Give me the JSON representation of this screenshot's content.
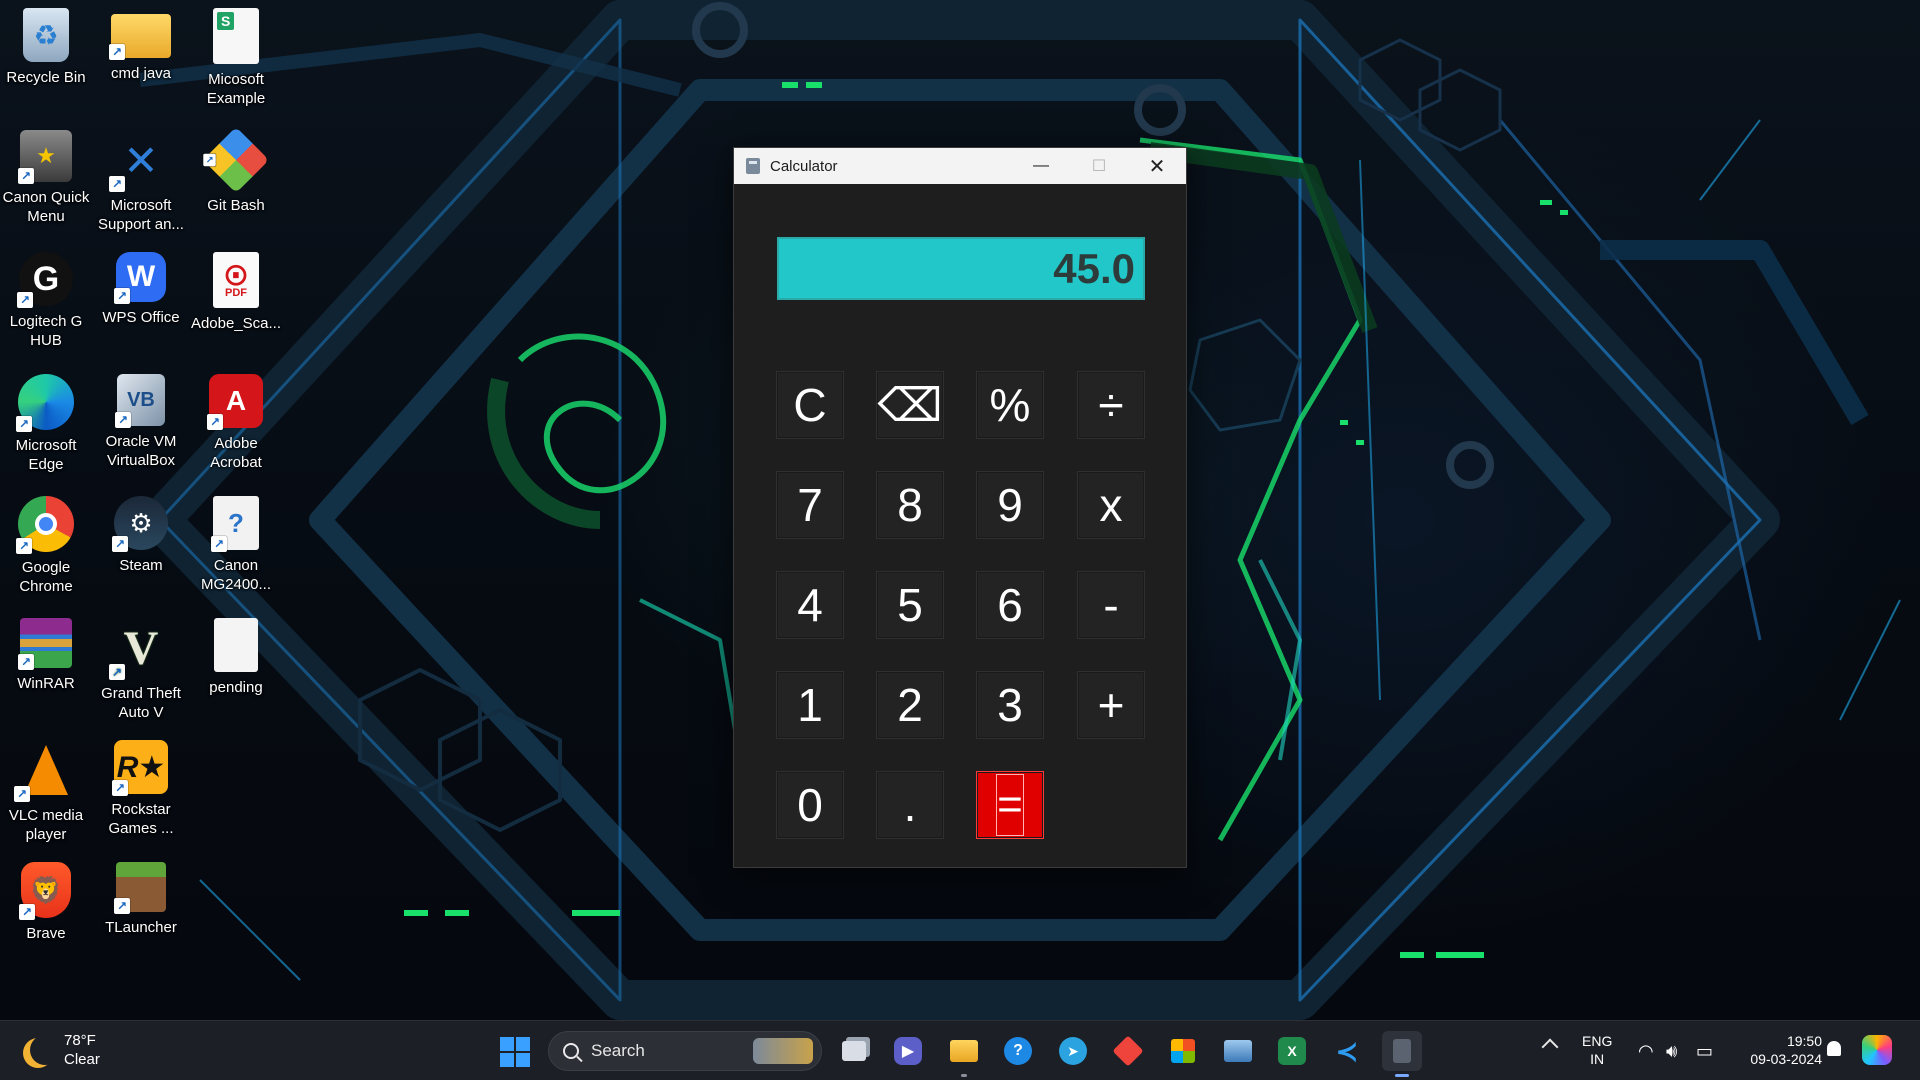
{
  "desktop": {
    "icons": [
      {
        "label": "Recycle Bin",
        "icon": "recycle-bin-icon"
      },
      {
        "label": "cmd java",
        "icon": "folder-icon"
      },
      {
        "label": "Micosoft\nExample",
        "icon": "spreadsheet-file-icon"
      },
      {
        "label": "Canon Quick\nMenu",
        "icon": "canon-quick-menu-icon"
      },
      {
        "label": "Microsoft\nSupport an...",
        "icon": "microsoft-support-icon"
      },
      {
        "label": "Git Bash",
        "icon": "git-bash-icon"
      },
      {
        "label": "Logitech G\nHUB",
        "icon": "logitech-g-hub-icon"
      },
      {
        "label": "WPS Office",
        "icon": "wps-office-icon"
      },
      {
        "label": "Adobe_Sca...",
        "icon": "pdf-file-icon"
      },
      {
        "label": "Microsoft\nEdge",
        "icon": "edge-icon"
      },
      {
        "label": "Oracle VM\nVirtualBox",
        "icon": "virtualbox-icon"
      },
      {
        "label": "Adobe\nAcrobat",
        "icon": "adobe-acrobat-icon"
      },
      {
        "label": "Google\nChrome",
        "icon": "chrome-icon"
      },
      {
        "label": "Steam",
        "icon": "steam-icon"
      },
      {
        "label": "Canon\nMG2400...",
        "icon": "canon-printer-help-icon"
      },
      {
        "label": "WinRAR",
        "icon": "winrar-icon"
      },
      {
        "label": "Grand Theft\nAuto V",
        "icon": "gta-v-icon"
      },
      {
        "label": "pending",
        "icon": "text-file-icon"
      },
      {
        "label": "VLC media\nplayer",
        "icon": "vlc-icon"
      },
      {
        "label": "Rockstar\nGames ...",
        "icon": "rockstar-games-icon"
      },
      {
        "label": "Brave",
        "icon": "brave-icon"
      },
      {
        "label": "TLauncher",
        "icon": "tlauncher-icon"
      }
    ]
  },
  "calculator": {
    "title": "Calculator",
    "display": "45.0",
    "display_color": "#22c8c9",
    "equals_color": "#e10000",
    "keys": [
      [
        "C",
        "⌫",
        "%",
        "÷"
      ],
      [
        "7",
        "8",
        "9",
        "x"
      ],
      [
        "4",
        "5",
        "6",
        "-"
      ],
      [
        "1",
        "2",
        "3",
        "+"
      ],
      [
        "0",
        ".",
        "="
      ]
    ]
  },
  "taskbar": {
    "weather": {
      "temp": "78°F",
      "condition": "Clear"
    },
    "search_label": "Search",
    "language": {
      "line1": "ENG",
      "line2": "IN"
    },
    "clock": {
      "time": "19:50",
      "date": "09-03-2024"
    },
    "apps": [
      "task-view-icon",
      "teams-chat-icon",
      "file-explorer-icon",
      "help-icon",
      "telegram-icon",
      "anydesk-icon",
      "microsoft-store-icon",
      "photos-icon",
      "excel-icon",
      "vscode-icon",
      "calculator-icon"
    ]
  }
}
